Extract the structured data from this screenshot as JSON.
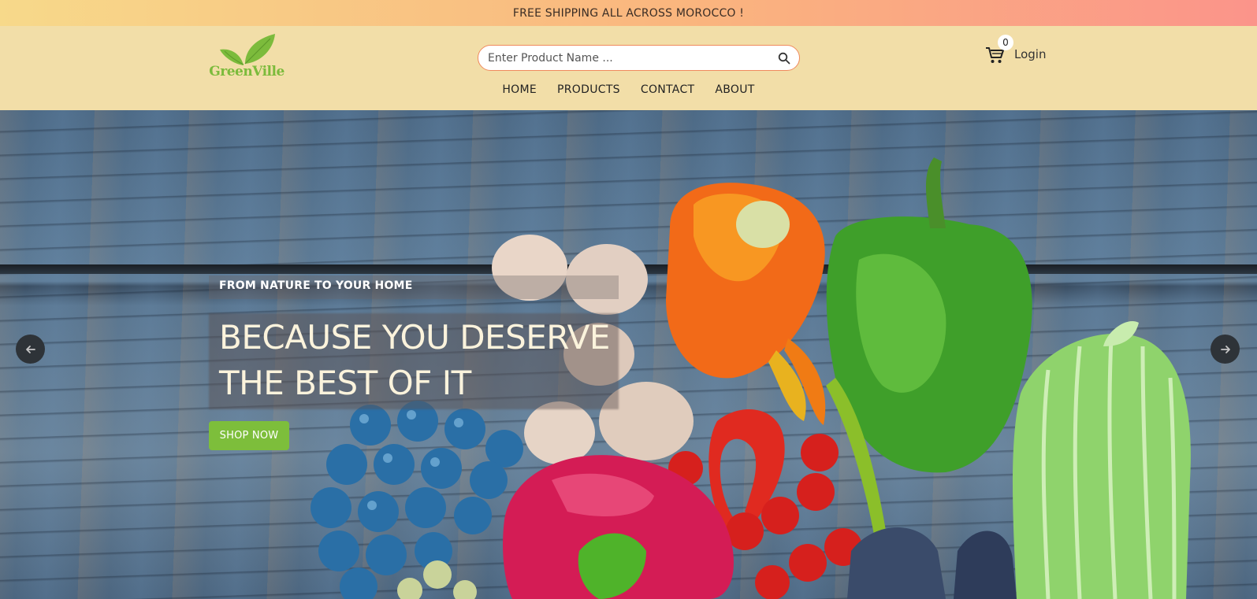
{
  "announcement": "FREE SHIPPING ALL ACROSS MOROCCO !",
  "brand": {
    "logo_text": "GreenVille",
    "color": "#7cbb3c"
  },
  "search": {
    "placeholder": "Enter Product Name ...",
    "value": "",
    "icon": "search-icon"
  },
  "cart": {
    "icon": "cart-icon",
    "count": "0"
  },
  "login_label": "Login",
  "nav": {
    "items": [
      {
        "label": "HOME"
      },
      {
        "label": "PRODUCTS"
      },
      {
        "label": "CONTACT"
      },
      {
        "label": "ABOUT"
      }
    ]
  },
  "hero": {
    "kicker": "FROM NATURE TO YOUR HOME",
    "headline_line1": "BECAUSE YOU DESERVE",
    "headline_line2": "THE BEST OF IT",
    "cta_label": "SHOP NOW",
    "cta_color": "#7dbe3b",
    "prev_icon": "arrow-left-icon",
    "next_icon": "arrow-right-icon"
  },
  "colors": {
    "header_bg": "#f2dea8",
    "search_border": "#f08a5d",
    "announcement_gradient": [
      "#f7d98a",
      "#fab57e",
      "#fb948a"
    ]
  }
}
